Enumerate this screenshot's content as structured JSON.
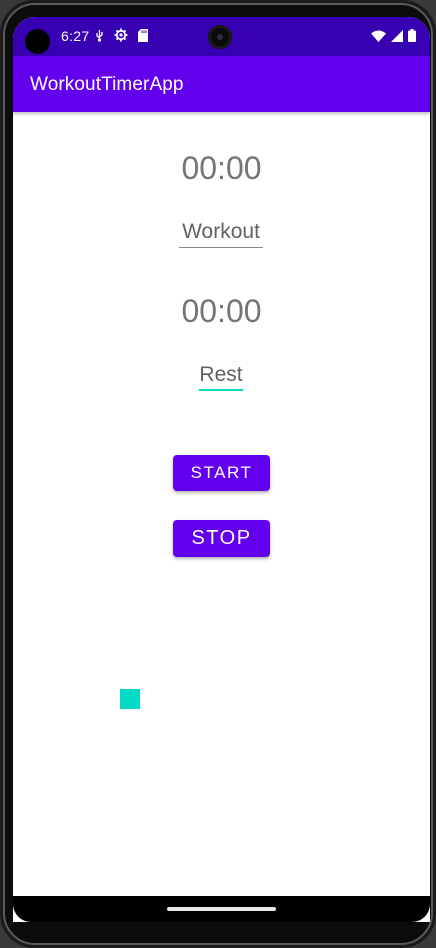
{
  "status_bar": {
    "time": "6:27",
    "left_icons": [
      "usb-debug-icon",
      "settings-icon",
      "sd-card-icon"
    ],
    "right_icons": [
      "wifi-icon",
      "signal-icon",
      "battery-icon"
    ],
    "color": "#3700b3"
  },
  "app_bar": {
    "title": "WorkoutTimerApp",
    "color": "#6200ee"
  },
  "workout": {
    "timer": "00:00",
    "label": "Workout"
  },
  "rest": {
    "timer": "00:00",
    "label": "Rest"
  },
  "buttons": {
    "start_label": "START",
    "stop_label": "STOP"
  },
  "colors": {
    "accent": "#03dac5",
    "primary": "#6200ee",
    "primary_dark": "#3700b3"
  }
}
